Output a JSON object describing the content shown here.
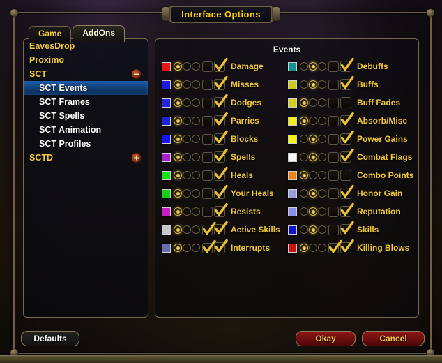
{
  "window": {
    "title": "Interface Options"
  },
  "tabs": [
    {
      "label": "Game",
      "active": false
    },
    {
      "label": "AddOns",
      "active": true
    }
  ],
  "sidebar": {
    "items": [
      {
        "label": "EavesDrop",
        "type": "category",
        "selected": false,
        "toggle": "none"
      },
      {
        "label": "Proximo",
        "type": "category",
        "selected": false,
        "toggle": "none"
      },
      {
        "label": "SCT",
        "type": "category",
        "selected": false,
        "toggle": "minus"
      },
      {
        "label": "SCT Events",
        "type": "child",
        "selected": true,
        "toggle": "none"
      },
      {
        "label": "SCT Frames",
        "type": "child",
        "selected": false,
        "toggle": "none"
      },
      {
        "label": "SCT Spells",
        "type": "child",
        "selected": false,
        "toggle": "none"
      },
      {
        "label": "SCT Animation",
        "type": "child",
        "selected": false,
        "toggle": "none"
      },
      {
        "label": "SCT Profiles",
        "type": "child",
        "selected": false,
        "toggle": "none"
      },
      {
        "label": "SCTD",
        "type": "category",
        "selected": false,
        "toggle": "plus"
      }
    ]
  },
  "events_panel": {
    "title": "Events",
    "left_column": [
      {
        "label": "Damage",
        "color": "#f01414",
        "radio": 0,
        "box_small": false,
        "box_large": true
      },
      {
        "label": "Misses",
        "color": "#1a1ae6",
        "radio": 0,
        "box_small": false,
        "box_large": true
      },
      {
        "label": "Dodges",
        "color": "#2424e0",
        "radio": 0,
        "box_small": false,
        "box_large": true
      },
      {
        "label": "Parries",
        "color": "#2020e2",
        "radio": 0,
        "box_small": false,
        "box_large": true
      },
      {
        "label": "Blocks",
        "color": "#1414f0",
        "radio": 0,
        "box_small": false,
        "box_large": true
      },
      {
        "label": "Spells",
        "color": "#a81ec8",
        "radio": 0,
        "box_small": false,
        "box_large": true
      },
      {
        "label": "Heals",
        "color": "#16e016",
        "radio": 0,
        "box_small": false,
        "box_large": true
      },
      {
        "label": "Your Heals",
        "color": "#18cf18",
        "radio": 0,
        "box_small": false,
        "box_large": true
      },
      {
        "label": "Resists",
        "color": "#c61ec6",
        "radio": 0,
        "box_small": false,
        "box_large": true
      },
      {
        "label": "Active Skills",
        "color": "#c8c8c8",
        "radio": 0,
        "box_small": true,
        "box_large": true
      },
      {
        "label": "Interrupts",
        "color": "#6b6bb4",
        "radio": 0,
        "box_small": true,
        "box_large": true
      }
    ],
    "right_column": [
      {
        "label": "Debuffs",
        "color": "#14938f",
        "radio": 1,
        "box_small": false,
        "box_large": true
      },
      {
        "label": "Buffs",
        "color": "#c8c81e",
        "radio": 1,
        "box_small": false,
        "box_large": true
      },
      {
        "label": "Buff Fades",
        "color": "#d2d21e",
        "radio": 0,
        "box_small": false,
        "box_large": false
      },
      {
        "label": "Absorb/Misc",
        "color": "#f0f014",
        "radio": 0,
        "box_small": false,
        "box_large": true
      },
      {
        "label": "Power Gains",
        "color": "#f5f50a",
        "radio": 1,
        "box_small": false,
        "box_large": true
      },
      {
        "label": "Combat Flags",
        "color": "#f5f5f5",
        "radio": 1,
        "box_small": false,
        "box_large": true
      },
      {
        "label": "Combo Points",
        "color": "#f08214",
        "radio": 0,
        "box_small": false,
        "box_large": false
      },
      {
        "label": "Honor Gain",
        "color": "#9b9be0",
        "radio": 1,
        "box_small": false,
        "box_large": true
      },
      {
        "label": "Reputation",
        "color": "#8d8df0",
        "radio": 1,
        "box_small": false,
        "box_large": true
      },
      {
        "label": "Skills",
        "color": "#1414c8",
        "radio": 1,
        "box_small": false,
        "box_large": true
      },
      {
        "label": "Killing Blows",
        "color": "#c81414",
        "radio": 0,
        "box_small": true,
        "box_large": true
      }
    ]
  },
  "footer": {
    "defaults_label": "Defaults",
    "okay_label": "Okay",
    "cancel_label": "Cancel"
  },
  "colors": {
    "gold_text": "#f0c838",
    "frame_border": "#6e6046",
    "selection_blue": "#1d5ca8",
    "button_red": "#8f1616"
  }
}
